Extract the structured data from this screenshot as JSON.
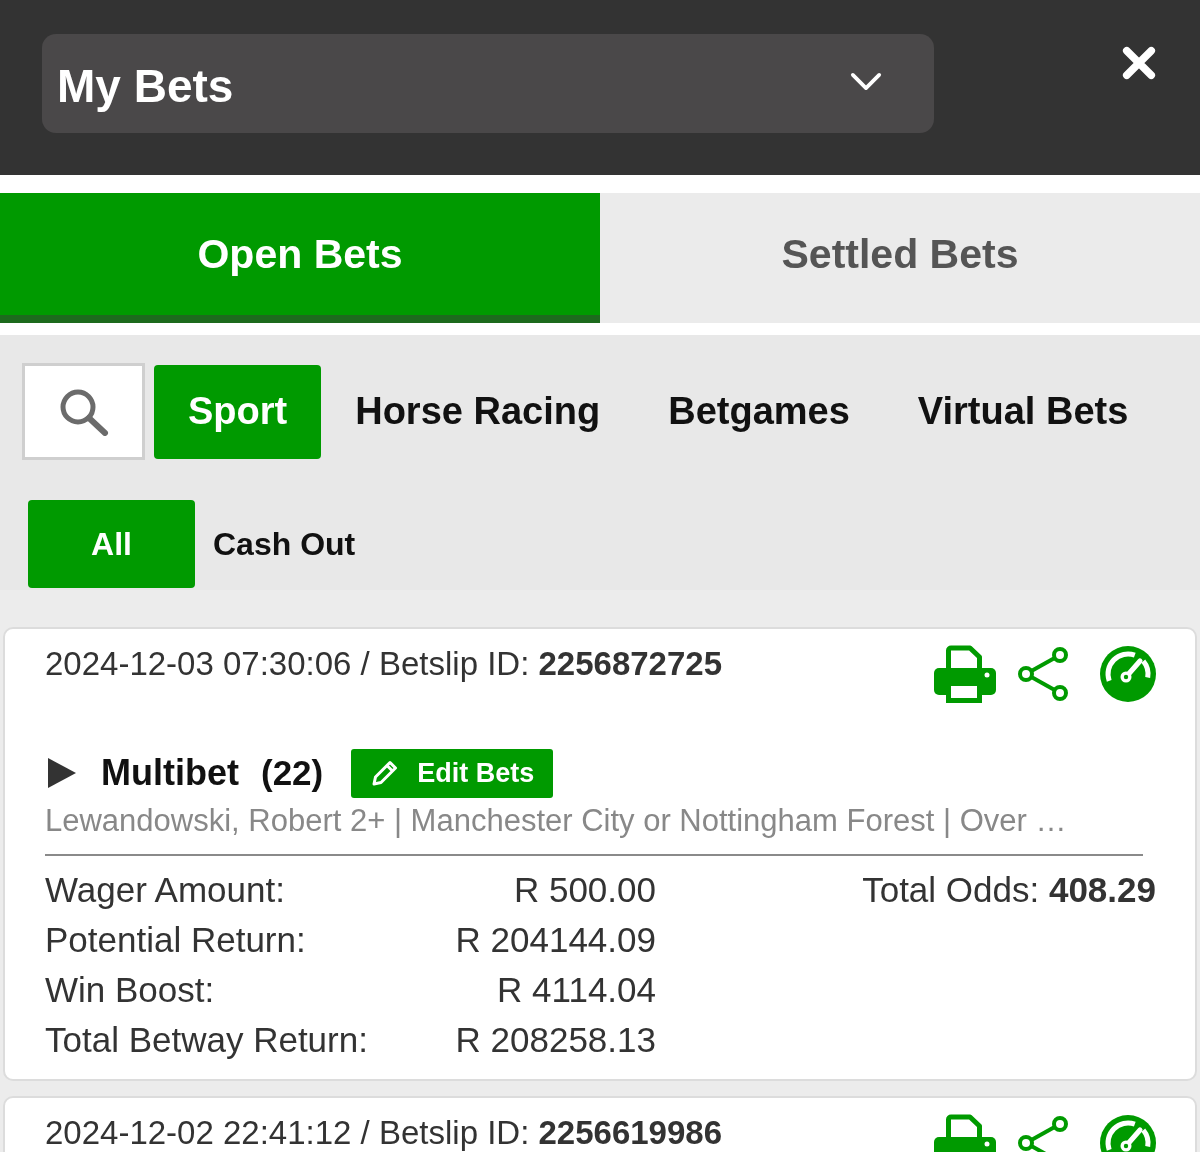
{
  "header": {
    "title": "My Bets"
  },
  "tabs": [
    {
      "label": "Open Bets",
      "selected": true
    },
    {
      "label": "Settled Bets",
      "selected": false
    }
  ],
  "categories": [
    {
      "label": "Sport",
      "selected": true
    },
    {
      "label": "Horse Racing",
      "selected": false
    },
    {
      "label": "Betgames",
      "selected": false
    },
    {
      "label": "Virtual Bets",
      "selected": false
    }
  ],
  "filters": [
    {
      "label": "All",
      "selected": true
    },
    {
      "label": "Cash Out",
      "selected": false
    }
  ],
  "bets": [
    {
      "header": "2024-12-03 07:30:06 / Betslip ID: **2256872725**",
      "expanded": false,
      "type": "Multibet",
      "count": "(22)",
      "edit_button": "Edit Bets",
      "selections": "Lewandowski, Robert 2+ | Manchester City or Nottingham Forest | Over …",
      "amounts": [
        {
          "label": "Wager Amount:",
          "value": "R 500.00"
        },
        {
          "label": "Potential Return:",
          "value": "R 204144.09"
        },
        {
          "label": "Win Boost:",
          "value": "R 4114.04"
        },
        {
          "label": "Total Betway Return:",
          "value": "R 208258.13"
        }
      ],
      "total_odds": "Total Odds: **408.29**"
    },
    {
      "header": "2024-12-02 22:41:12 / Betslip ID: **2256619986**"
    }
  ]
}
